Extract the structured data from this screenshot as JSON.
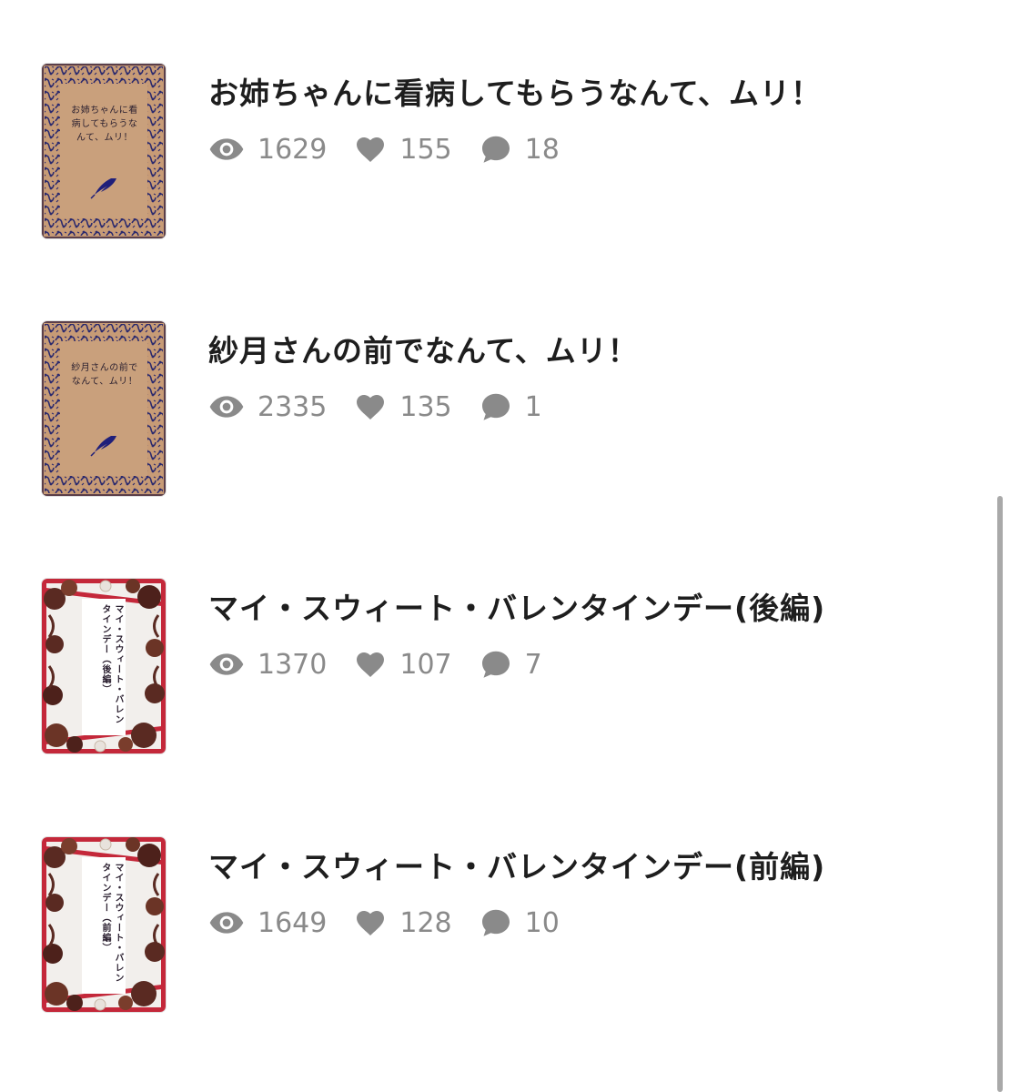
{
  "works": [
    {
      "title": "お姉ちゃんに看病してもらうなんて、ムリ！",
      "cover_text": "お姉ちゃんに看病してもらうなんて、ムリ！",
      "cover_style": "book",
      "views": "1629",
      "likes": "155",
      "comments": "18"
    },
    {
      "title": "紗月さんの前でなんて、ムリ！",
      "cover_text": "紗月さんの前でなんて、ムリ！",
      "cover_style": "book",
      "views": "2335",
      "likes": "135",
      "comments": "1"
    },
    {
      "title": "マイ・スウィート・バレンタインデー(後編)",
      "cover_text": "マイ・スウィート・バレンタインデー（後編）",
      "cover_style": "chocolate",
      "views": "1370",
      "likes": "107",
      "comments": "7"
    },
    {
      "title": "マイ・スウィート・バレンタインデー(前編)",
      "cover_text": "マイ・スウィート・バレンタインデー（前編）",
      "cover_style": "chocolate",
      "views": "1649",
      "likes": "128",
      "comments": "10"
    }
  ],
  "icons": {
    "views": "eye-icon",
    "likes": "heart-icon",
    "comments": "speech-bubble-icon"
  },
  "colors": {
    "stat_text": "#8a8a8a",
    "title_text": "#1e1e1e",
    "book_cover_bg": "#c79b76",
    "book_cover_ornament": "#2b2a6e",
    "chocolate_frame": "#c4283a",
    "chocolate_brown": "#5a2a22"
  }
}
